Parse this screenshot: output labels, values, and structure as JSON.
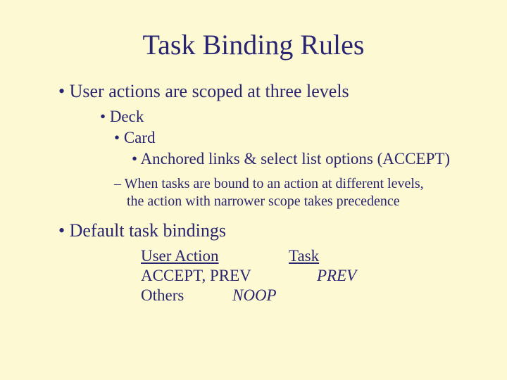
{
  "title": "Task Binding Rules",
  "b1": "User actions are scoped at three levels",
  "b1a": "Deck",
  "b1b": "Card",
  "b1c": "Anchored links  & select list options  (ACCEPT)",
  "b1d": "When tasks are bound to an action at different levels, the action with narrower scope takes precedence",
  "b2": "Default task bindings",
  "tbl": {
    "h1": "User Action",
    "h2": "Task",
    "r1c1": "ACCEPT, PREV",
    "r1c2": "PREV",
    "r2c1": "Others",
    "r2c2": "NOOP"
  }
}
